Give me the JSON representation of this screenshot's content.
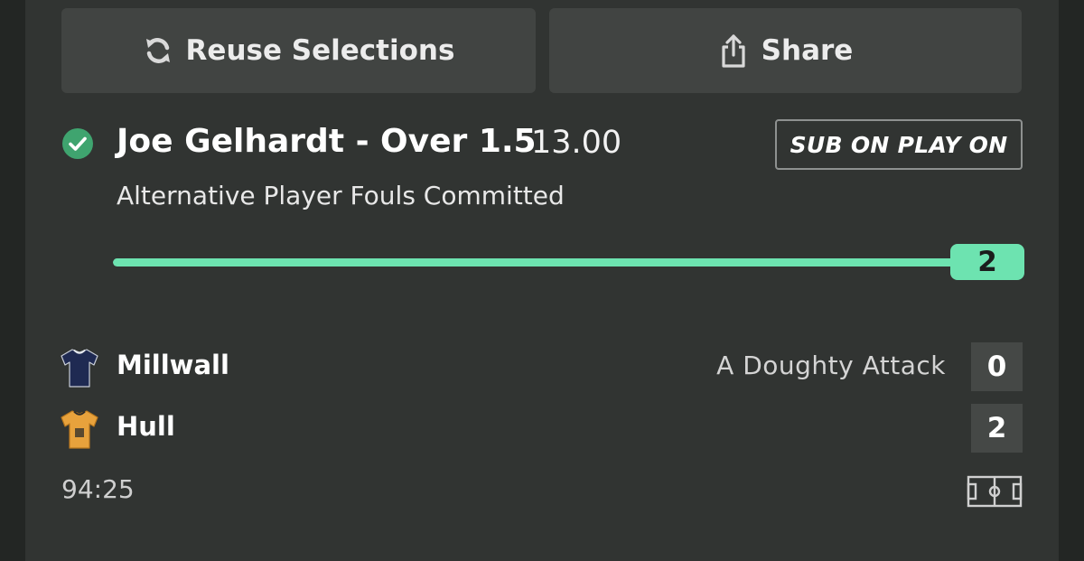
{
  "actions": {
    "reuse_label": "Reuse Selections",
    "share_label": "Share"
  },
  "selection": {
    "title": "Joe Gelhardt - Over 1.5",
    "odds": "13.00",
    "badge": "SUB ON PLAY ON",
    "market": "Alternative Player Fouls Committed",
    "status": "settled-won",
    "progress": {
      "current": "2",
      "target": 2,
      "fill_fraction": 1.0
    }
  },
  "match": {
    "home": {
      "name": "Millwall",
      "score": "0",
      "event": "A Doughty Attack",
      "shirt_color": "#1f2a52"
    },
    "away": {
      "name": "Hull",
      "score": "2",
      "shirt_color": "#e8a23c"
    },
    "clock": "94:25"
  },
  "icons": {
    "reuse": "refresh-icon",
    "share": "share-icon",
    "status": "check-circle-icon",
    "pitch": "pitch-icon"
  },
  "colors": {
    "accent": "#6de3b0",
    "check": "#3fa46f",
    "card": "#313432",
    "button": "#414442"
  }
}
